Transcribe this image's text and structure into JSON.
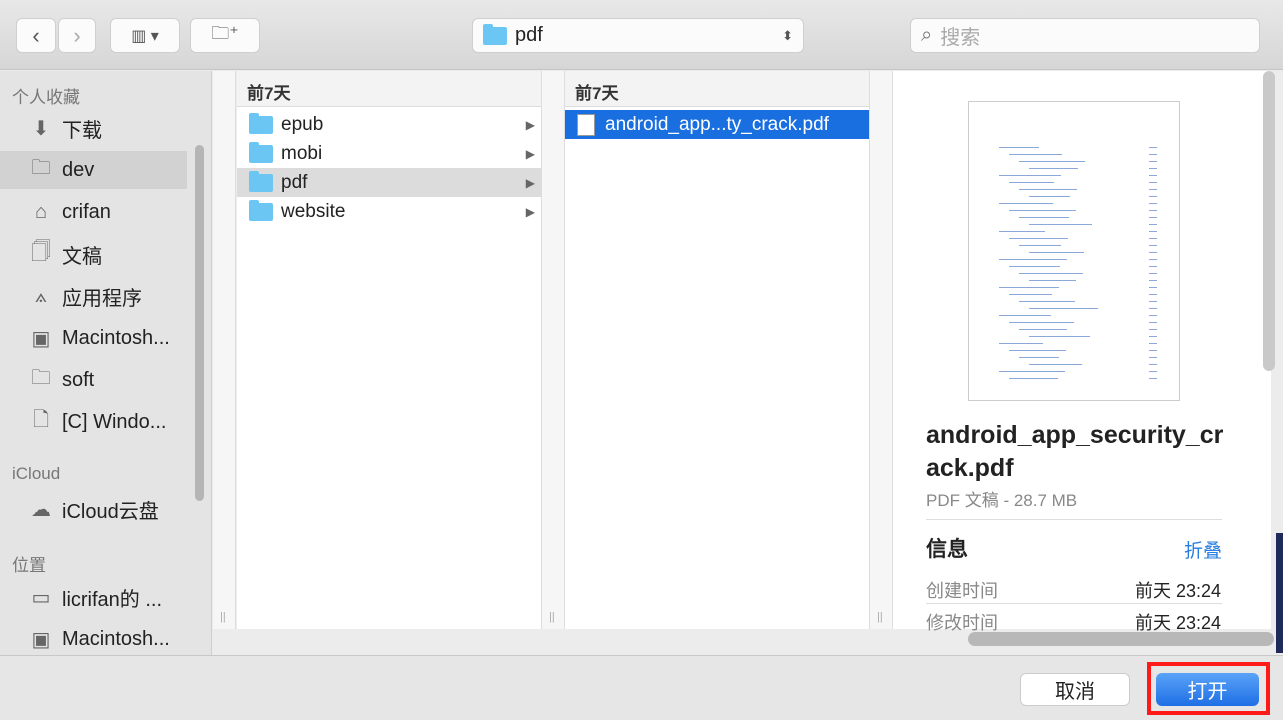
{
  "toolbar": {
    "back_icon": "chevron-left",
    "forward_icon": "chevron-right",
    "view_icon": "columns-view",
    "new_folder_icon": "new-folder",
    "path": "pdf",
    "search_placeholder": "搜索"
  },
  "sidebar": {
    "sections": [
      {
        "title": "个人收藏",
        "items": [
          {
            "label": "下载",
            "icon": "download"
          },
          {
            "label": "dev",
            "icon": "folder",
            "selected": true
          },
          {
            "label": "crifan",
            "icon": "home"
          },
          {
            "label": "文稿",
            "icon": "documents"
          },
          {
            "label": "应用程序",
            "icon": "applications"
          },
          {
            "label": "Macintosh...",
            "icon": "disk"
          },
          {
            "label": "soft",
            "icon": "folder"
          },
          {
            "label": "[C] Windo...",
            "icon": "file"
          }
        ]
      },
      {
        "title": "iCloud",
        "items": [
          {
            "label": "iCloud云盘",
            "icon": "cloud"
          }
        ]
      },
      {
        "title": "位置",
        "items": [
          {
            "label": "licrifan的 ...",
            "icon": "laptop"
          },
          {
            "label": "Macintosh...",
            "icon": "disk"
          }
        ]
      }
    ]
  },
  "columns": [
    {
      "header": "前7天",
      "items": [
        {
          "label": "epub"
        },
        {
          "label": "mobi"
        },
        {
          "label": "pdf",
          "selected": true
        },
        {
          "label": "website"
        }
      ]
    },
    {
      "header": "前7天",
      "items": [
        {
          "label": "android_app...ty_crack.pdf",
          "active": true
        }
      ]
    }
  ],
  "preview": {
    "filename": "android_app_security_crack.pdf",
    "kind_size": "PDF 文稿 - 28.7 MB",
    "info_title": "信息",
    "collapse": "折叠",
    "rows": [
      {
        "label": "创建时间",
        "value": "前天 23:24"
      },
      {
        "label": "修改时间",
        "value": "前天 23:24"
      }
    ]
  },
  "footer": {
    "cancel": "取消",
    "open": "打开"
  },
  "colors": {
    "accent": "#1a6fe0",
    "highlight_box": "#ff1a1a",
    "link": "#2a7de1"
  }
}
